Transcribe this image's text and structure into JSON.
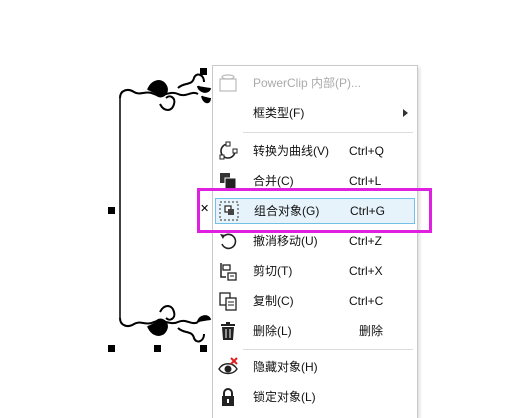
{
  "context_menu": {
    "items": [
      {
        "label": "PowerClip 内部(P)...",
        "shortcut": "",
        "icon": "powerclip-icon",
        "disabled": true
      },
      {
        "label": "框类型(F)",
        "shortcut": "",
        "icon": "",
        "submenu": true
      },
      {
        "label": "转换为曲线(V)",
        "shortcut": "Ctrl+Q",
        "icon": "convert-to-curves-icon"
      },
      {
        "label": "合并(C)",
        "shortcut": "Ctrl+L",
        "icon": "combine-icon"
      },
      {
        "label": "组合对象(G)",
        "shortcut": "Ctrl+G",
        "icon": "group-objects-icon",
        "highlighted": true
      },
      {
        "label": "撤消移动(U)",
        "shortcut": "Ctrl+Z",
        "icon": "undo-icon"
      },
      {
        "label": "剪切(T)",
        "shortcut": "Ctrl+X",
        "icon": "cut-icon"
      },
      {
        "label": "复制(C)",
        "shortcut": "Ctrl+C",
        "icon": "copy-icon"
      },
      {
        "label": "删除(L)",
        "shortcut": "删除",
        "icon": "trash-icon"
      },
      {
        "label": "隐藏对象(H)",
        "shortcut": "",
        "icon": "hide-object-icon"
      },
      {
        "label": "锁定对象(L)",
        "shortcut": "",
        "icon": "lock-icon"
      }
    ]
  },
  "colors": {
    "highlight_bg": "#e6f3fb",
    "highlight_border": "#70c0e7",
    "annotation_box": "#e020e0",
    "disabled_text": "#aaaaaa"
  }
}
